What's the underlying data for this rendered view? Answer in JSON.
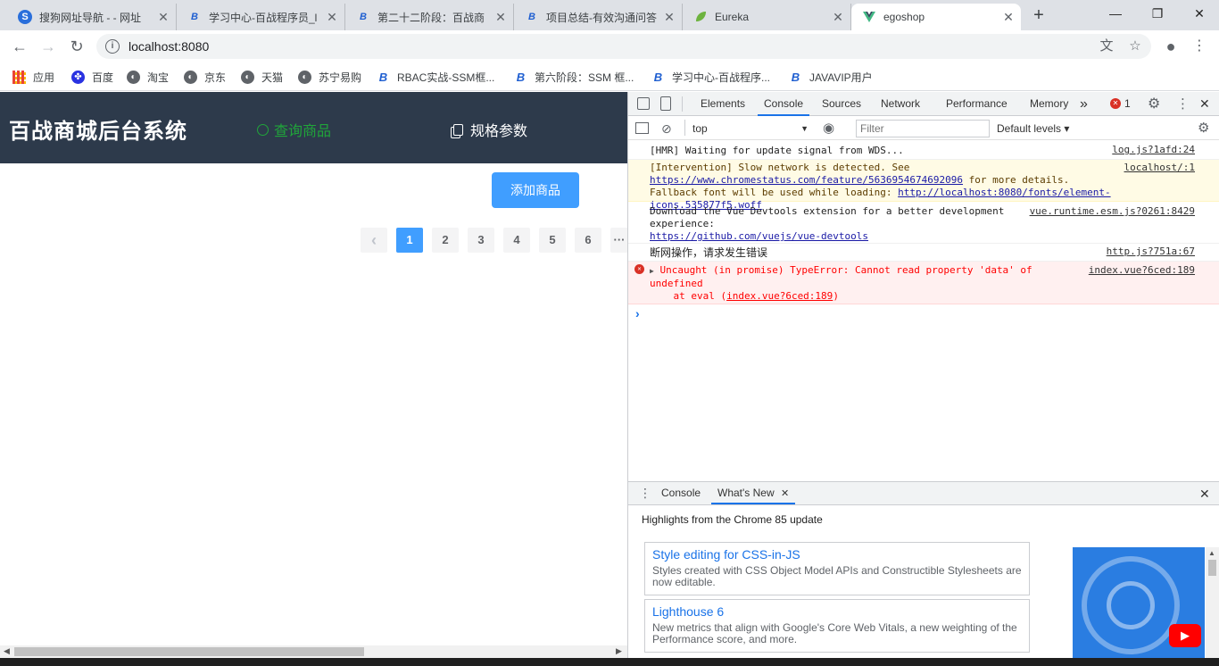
{
  "browser": {
    "tabs": [
      {
        "label": "搜狗网址导航 - - 网址",
        "icon": "sogou-icon"
      },
      {
        "label": "学习中心-百战程序员_l",
        "icon": "bjsxt-icon"
      },
      {
        "label": "第二十二阶段：百战商",
        "icon": "bjsxt-icon"
      },
      {
        "label": "项目总结-有效沟通问答",
        "icon": "bjsxt-icon"
      },
      {
        "label": "Eureka",
        "icon": "spring-leaf-icon"
      },
      {
        "label": "egoshop",
        "icon": "vue-icon"
      }
    ],
    "new_tab": "+",
    "url": "localhost:8080",
    "bookmarks": [
      {
        "label": "应用"
      },
      {
        "label": "百度"
      },
      {
        "label": "淘宝"
      },
      {
        "label": "京东"
      },
      {
        "label": "天猫"
      },
      {
        "label": "苏宁易购"
      },
      {
        "label": "RBAC实战-SSM框..."
      },
      {
        "label": "第六阶段：SSM 框..."
      },
      {
        "label": "学习中心-百战程序..."
      },
      {
        "label": "JAVAVIP用户"
      }
    ]
  },
  "page": {
    "title": "百战商城后台系统",
    "menu": [
      "查询商品",
      "规格参数"
    ],
    "add_button": "添加商品",
    "pagination": {
      "prev": "‹",
      "pages": [
        "1",
        "2",
        "3",
        "4",
        "5",
        "6"
      ],
      "current": "1",
      "more": "···"
    }
  },
  "devtools": {
    "tabs": [
      "Elements",
      "Console",
      "Sources",
      "Network",
      "Performance",
      "Memory"
    ],
    "more_tabs": "»",
    "error_count": "1",
    "context": "top",
    "filter_placeholder": "Filter",
    "levels": "Default levels ▾",
    "messages": {
      "hmr": {
        "text": "[HMR] Waiting for update signal from WDS...",
        "src": "log.js?1afd:24"
      },
      "intervention": {
        "text1": "[Intervention] Slow network is detected. See ",
        "link1": "https://www.chromestatus.com/featu",
        "link1b": "re/5636954674692096",
        "text2": " for more details. Fallback font will be used while loading: ",
        "link2": "http://localh",
        "link2b": "ost:8080/fonts/element-icons.535877f5.woff",
        "src": "localhost/:1"
      },
      "vue": {
        "text": "Download the Vue Devtools extension for a better development experience:",
        "link": "https://github.com/vuejs/vue-devtools",
        "src": "vue.runtime.esm.js?0261:8429"
      },
      "network": {
        "text": "断网操作，请求发生错误",
        "src": "http.js?751a:67"
      },
      "error": {
        "line1": "Uncaught (in promise) TypeError: Cannot read property 'data' of",
        "line2": "undefined",
        "line3_pre": "    at eval (",
        "line3_link": "index.vue?6ced:189",
        "line3_post": ")",
        "src": "index.vue?6ced:189"
      }
    },
    "prompt": "›",
    "drawer": {
      "tabs": [
        "Console",
        "What's New"
      ],
      "highlights": "Highlights from the Chrome 85 update",
      "cards": [
        {
          "title": "Style editing for CSS-in-JS",
          "desc": "Styles created with CSS Object Model APIs and Constructible Stylesheets are now editable."
        },
        {
          "title": "Lighthouse 6",
          "desc": "New metrics that align with Google's Core Web Vitals, a new weighting of the Performance score, and more."
        }
      ]
    }
  },
  "colors": {
    "primary": "#409eff",
    "header_bg": "#2d3a4b",
    "active_menu": "#20a53a",
    "error": "#ff0000"
  }
}
